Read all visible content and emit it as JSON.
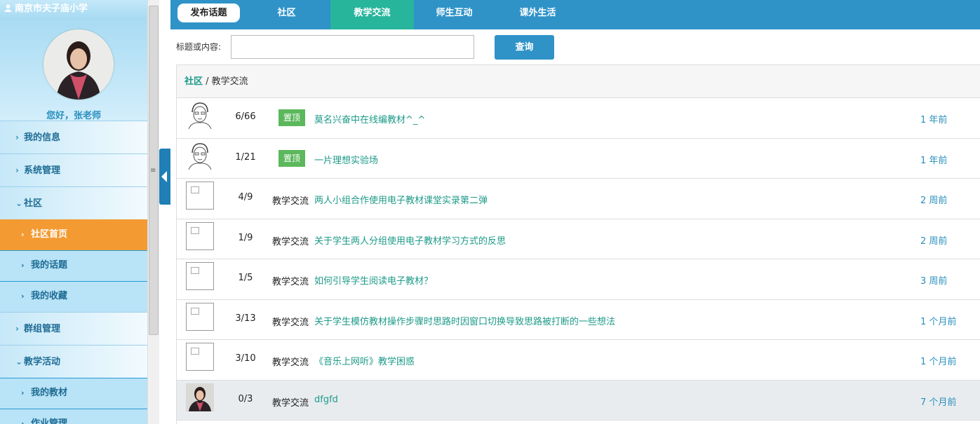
{
  "sidebar": {
    "school": "南京市夫子庙小学",
    "greeting": "您好，张老师",
    "nav": [
      {
        "label": "我的信息",
        "type": "top"
      },
      {
        "label": "系统管理",
        "type": "top"
      },
      {
        "label": "社区",
        "type": "top-open"
      },
      {
        "label": "社区首页",
        "type": "sub-active"
      },
      {
        "label": "我的话题",
        "type": "sub"
      },
      {
        "label": "我的收藏",
        "type": "sub"
      },
      {
        "label": "群组管理",
        "type": "top"
      },
      {
        "label": "教学活动",
        "type": "top-open"
      },
      {
        "label": "我的教材",
        "type": "sub"
      },
      {
        "label": "作业管理",
        "type": "sub"
      }
    ]
  },
  "topbar": {
    "post_label": "发布话题",
    "tabs": [
      {
        "label": "社区"
      },
      {
        "label": "教学交流"
      },
      {
        "label": "师生互动"
      },
      {
        "label": "课外生活"
      }
    ]
  },
  "search": {
    "label": "标题或内容:",
    "value": "",
    "button": "查询"
  },
  "crumb": {
    "root": "社区",
    "sep": " / ",
    "current": "教学交流"
  },
  "rows": [
    {
      "avatar": "sketch",
      "ratio": "6/66",
      "pin": "置顶",
      "category": "",
      "title": "莫名兴奋中在线编教材^_^",
      "time": "1 年前"
    },
    {
      "avatar": "sketch",
      "ratio": "1/21",
      "pin": "置顶",
      "category": "",
      "title": "一片理想实验场",
      "time": "1 年前"
    },
    {
      "avatar": "placeholder",
      "ratio": "4/9",
      "pin": "",
      "category": "教学交流",
      "title": "两人小组合作使用电子教材课堂实录第二弹",
      "time": "2 周前"
    },
    {
      "avatar": "placeholder",
      "ratio": "1/9",
      "pin": "",
      "category": "教学交流",
      "title": "关于学生两人分组使用电子教材学习方式的反思",
      "time": "2 周前"
    },
    {
      "avatar": "placeholder",
      "ratio": "1/5",
      "pin": "",
      "category": "教学交流",
      "title": "如何引导学生阅读电子教材？",
      "time": "3 周前"
    },
    {
      "avatar": "placeholder",
      "ratio": "3/13",
      "pin": "",
      "category": "教学交流",
      "title": "关于学生模仿教材操作步骤时思路时因窗口切换导致思路被打断的一些想法",
      "time": "1 个月前"
    },
    {
      "avatar": "placeholder",
      "ratio": "3/10",
      "pin": "",
      "category": "教学交流",
      "title": "《音乐上网听》教学困惑",
      "time": "1 个月前"
    },
    {
      "avatar": "photo",
      "ratio": "0/3",
      "pin": "",
      "category": "教学交流",
      "title": "dfgfd",
      "time": "7 个月前",
      "highlight": true
    }
  ]
}
